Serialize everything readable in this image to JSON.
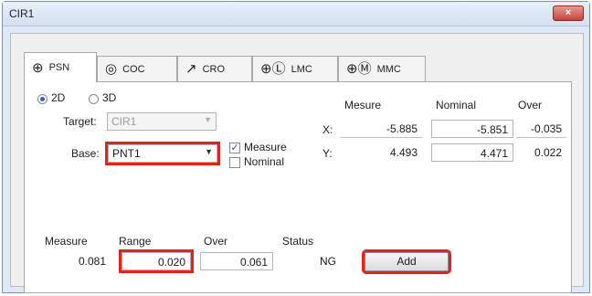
{
  "window": {
    "title": "CIR1",
    "close_label": "×"
  },
  "tabs": [
    {
      "label": "PSN",
      "icon": "crosshair-icon",
      "glyph": "⊕"
    },
    {
      "label": "COC",
      "icon": "concentric-circle-icon",
      "glyph": "◎"
    },
    {
      "label": "CRO",
      "icon": "arrow-icon",
      "glyph": "↗"
    },
    {
      "label": "LMC",
      "icon": "lmc-icon",
      "glyph": "⊕Ⓛ"
    },
    {
      "label": "MMC",
      "icon": "mmc-icon",
      "glyph": "⊕Ⓜ"
    }
  ],
  "mode": {
    "opt_2d": "2D",
    "opt_3d": "3D",
    "selected": "2D"
  },
  "target": {
    "label": "Target:",
    "value": "CIR1"
  },
  "base": {
    "label": "Base:",
    "value": "PNT1"
  },
  "checks": {
    "measure": "Measure",
    "measure_checked": true,
    "nominal": "Nominal",
    "nominal_checked": false
  },
  "table": {
    "headers": [
      "Mesure",
      "Nominal",
      "Over"
    ],
    "rows": [
      {
        "axis": "X:",
        "mesure": "-5.885",
        "nominal": "-5.851",
        "over": "-0.035"
      },
      {
        "axis": "Y:",
        "mesure": "4.493",
        "nominal": "4.471",
        "over": "0.022"
      }
    ]
  },
  "summary": {
    "measure_label": "Measure",
    "measure": "0.081",
    "range_label": "Range",
    "range": "0.020",
    "over_label": "Over",
    "over": "0.061",
    "status_label": "Status",
    "status": "NG"
  },
  "add_button": "Add",
  "colors": {
    "highlight": "#e0231b",
    "titlebar": "#dfe9f5",
    "close": "#c7443a"
  }
}
